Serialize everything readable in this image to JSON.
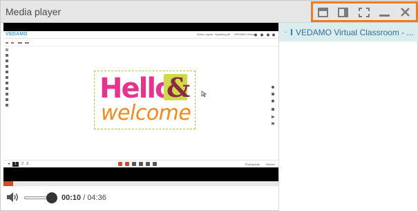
{
  "window": {
    "title": "Media player",
    "controls": [
      {
        "icon": "restore-window-icon"
      },
      {
        "icon": "maximize-window-icon"
      },
      {
        "icon": "fullscreen-icon"
      },
      {
        "icon": "minimize-icon"
      },
      {
        "icon": "close-icon"
      }
    ],
    "highlight_color": "#f07a1e"
  },
  "video": {
    "app": {
      "logo": "VEDAMO",
      "menu": [
        "Video Layout",
        "Speaking All",
        "VEDAMO Demo"
      ],
      "pages": [
        "1",
        "2",
        "3"
      ],
      "bottom_right": [
        "Participants",
        "Stream"
      ]
    },
    "board": {
      "hello": "Hello",
      "amp": "&",
      "welcome": "welcome",
      "colors": {
        "hello": "#e8338c",
        "amp_bg": "#cfd94a",
        "amp": "#8a2b3f",
        "welcome": "#f08a1e"
      }
    }
  },
  "player": {
    "progress": 0.035,
    "progress_color": "#d14a2e",
    "volume": 0.7,
    "current_time": "00:10",
    "separator": " / ",
    "duration": "04:36"
  },
  "playlist": {
    "items": [
      {
        "label": "VEDAMO Virtual Classroom - ...",
        "selected": true
      }
    ]
  }
}
